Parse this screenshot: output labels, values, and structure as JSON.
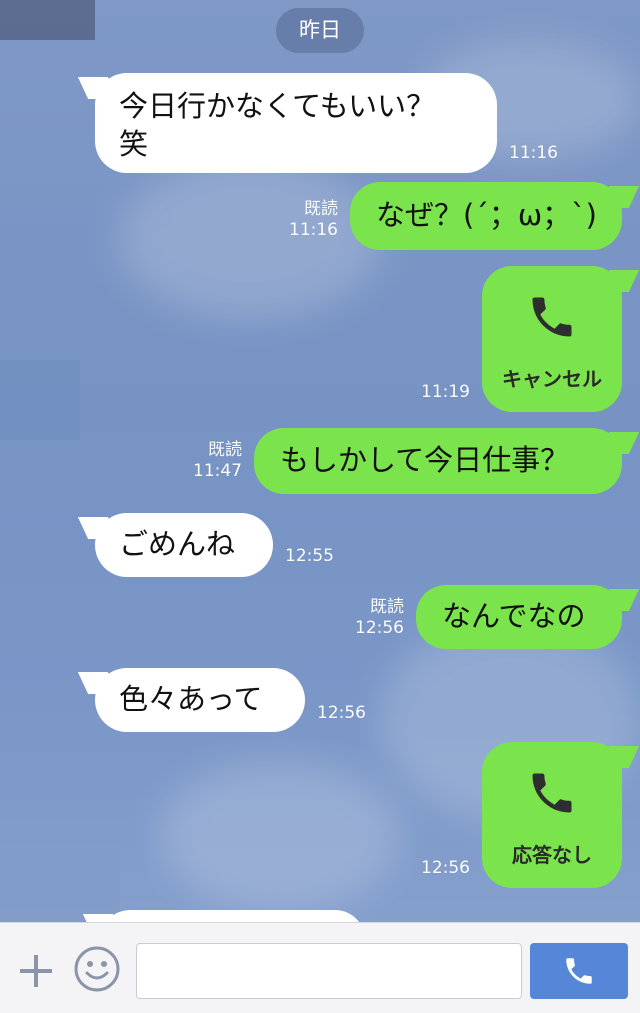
{
  "date_separator": "昨日",
  "messages": [
    {
      "side": "left",
      "text_line1": "今日行かなくてもいい？",
      "text_line2": "笑",
      "time": "11:16"
    },
    {
      "side": "right",
      "text": "なぜ？(´；ω；`)",
      "read": "既読",
      "time": "11:16"
    },
    {
      "side": "right",
      "type": "call",
      "icon": "phone-icon",
      "label": "キャンセル",
      "time": "11:19"
    },
    {
      "side": "right",
      "text": "もしかして今日仕事？",
      "read": "既読",
      "time": "11:47"
    },
    {
      "side": "left",
      "text": "ごめんね",
      "time": "12:55"
    },
    {
      "side": "right",
      "text": "なんでなの",
      "read": "既読",
      "time": "12:56"
    },
    {
      "side": "left",
      "text": "色々あって",
      "time": "12:56"
    },
    {
      "side": "right",
      "type": "call",
      "icon": "phone-icon",
      "label": "応答なし",
      "time": "12:56"
    }
  ],
  "input_bar": {
    "plus_icon": "plus-icon",
    "emoji_icon": "emoji-icon",
    "input_value": "",
    "call_icon": "phone-icon"
  },
  "colors": {
    "sent_bubble": "#7be34c",
    "received_bubble": "#ffffff",
    "call_button": "#5586d8",
    "background": "#7793c4"
  }
}
